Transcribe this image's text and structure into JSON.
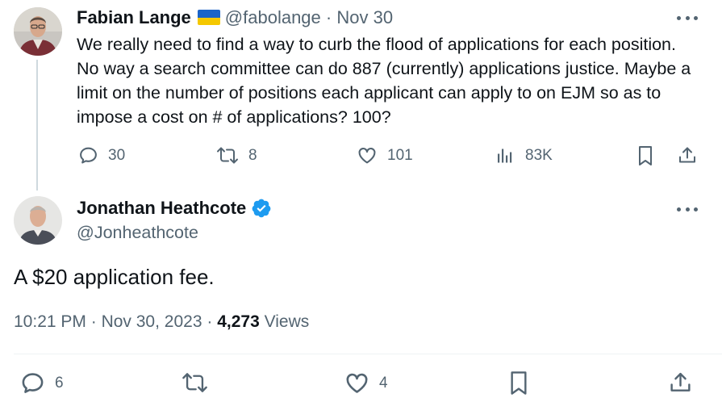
{
  "tweet1": {
    "author_name": "Fabian Lange",
    "handle": "@fabolange",
    "separator": "·",
    "date": "Nov 30",
    "text": "We really need to find a way to curb the flood of applications for each position. No way a search committee can do 887 (currently) applications justice. Maybe a limit on the number of positions each applicant can apply to on EJM so as to impose a cost on # of applications? 100?",
    "replies": "30",
    "retweets": "8",
    "likes": "101",
    "views": "83K"
  },
  "tweet2": {
    "author_name": "Jonathan Heathcote",
    "handle": "@Jonheathcote",
    "verified": true,
    "text": "A $20 application fee.",
    "time": "10:21 PM",
    "date": "Nov 30, 2023",
    "views_count": "4,273",
    "views_label": "Views",
    "separator": "·",
    "replies": "6",
    "retweets": "",
    "likes": "4"
  },
  "colors": {
    "text_primary": "#0f1419",
    "text_secondary": "#536471",
    "verified_blue": "#1d9bf0",
    "flag_blue": "#1b64c8",
    "flag_yellow": "#f5c800",
    "thread_line": "#cfd9de"
  },
  "icons": [
    "reply-icon",
    "retweet-icon",
    "like-icon",
    "views-icon",
    "bookmark-icon",
    "share-icon",
    "more-icon",
    "verified-badge-icon",
    "ukraine-flag-icon"
  ]
}
